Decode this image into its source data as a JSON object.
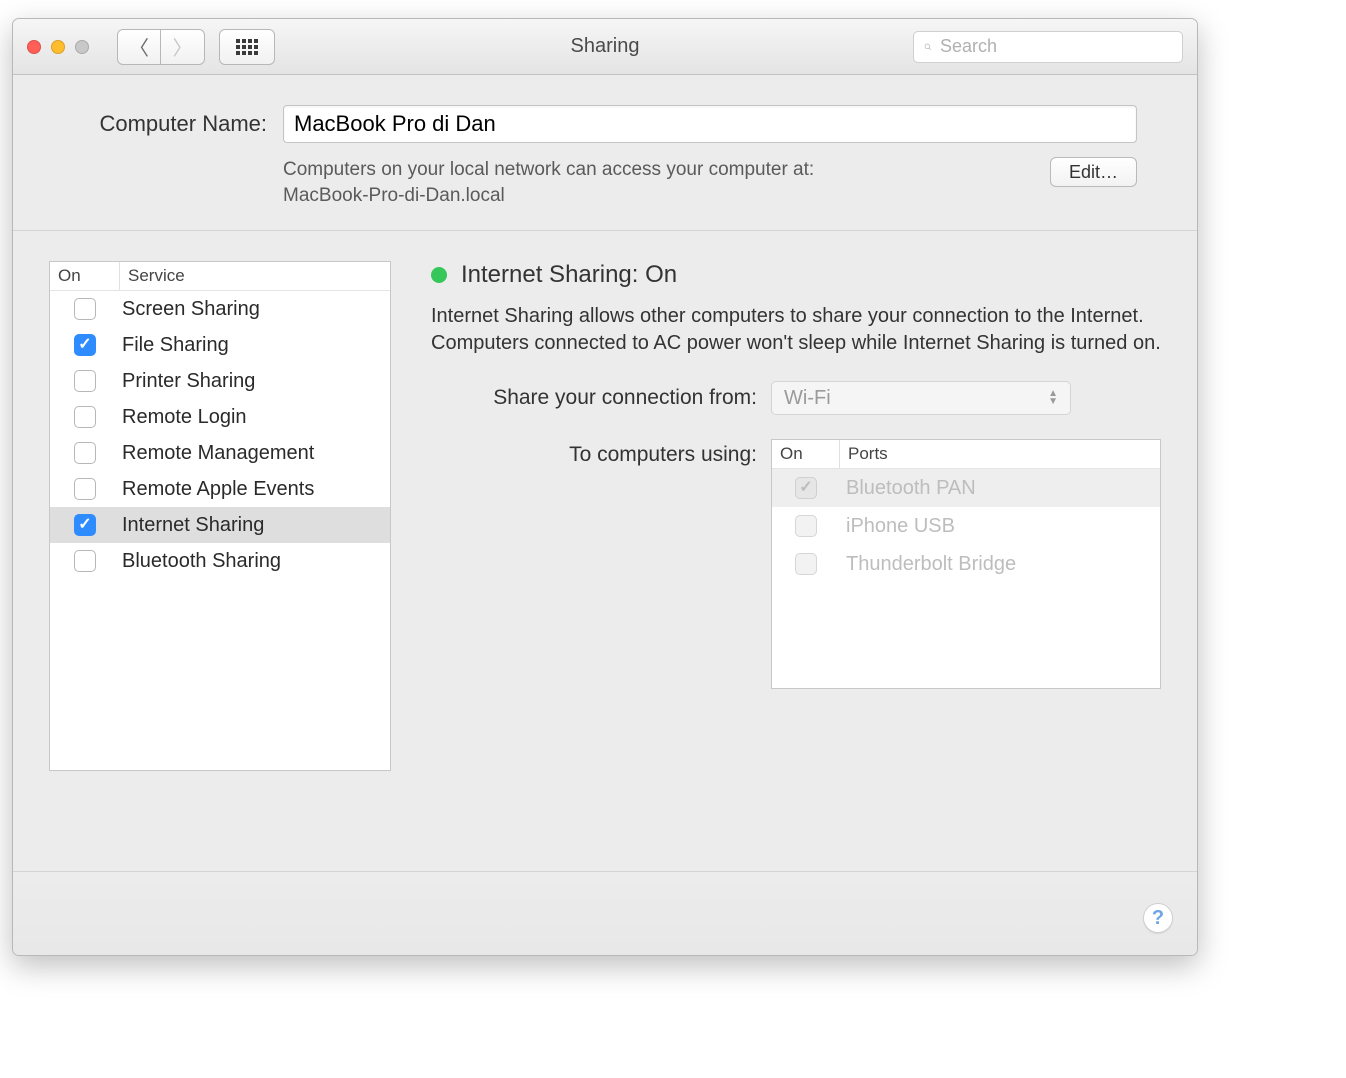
{
  "window": {
    "title": "Sharing"
  },
  "search": {
    "placeholder": "Search"
  },
  "computer_name": {
    "label": "Computer Name:",
    "value": "MacBook Pro di Dan",
    "hint_line1": "Computers on your local network can access your computer at:",
    "hint_line2": "MacBook-Pro-di-Dan.local",
    "edit_label": "Edit…"
  },
  "services": {
    "header_on": "On",
    "header_service": "Service",
    "items": [
      {
        "label": "Screen Sharing",
        "on": false,
        "selected": false
      },
      {
        "label": "File Sharing",
        "on": true,
        "selected": false
      },
      {
        "label": "Printer Sharing",
        "on": false,
        "selected": false
      },
      {
        "label": "Remote Login",
        "on": false,
        "selected": false
      },
      {
        "label": "Remote Management",
        "on": false,
        "selected": false
      },
      {
        "label": "Remote Apple Events",
        "on": false,
        "selected": false
      },
      {
        "label": "Internet Sharing",
        "on": true,
        "selected": true
      },
      {
        "label": "Bluetooth Sharing",
        "on": false,
        "selected": false
      }
    ]
  },
  "detail": {
    "status_label": "Internet Sharing: On",
    "status_color": "#35c759",
    "description": "Internet Sharing allows other computers to share your connection to the Internet. Computers connected to AC power won't sleep while Internet Sharing is turned on.",
    "share_from_label": "Share your connection from:",
    "share_from_selected": "Wi-Fi",
    "to_using_label": "To computers using:",
    "ports_header_on": "On",
    "ports_header_ports": "Ports",
    "ports": [
      {
        "label": "Bluetooth PAN",
        "on": true,
        "selected": true
      },
      {
        "label": "iPhone USB",
        "on": false,
        "selected": false
      },
      {
        "label": "Thunderbolt Bridge",
        "on": false,
        "selected": false
      }
    ]
  },
  "help_label": "?"
}
